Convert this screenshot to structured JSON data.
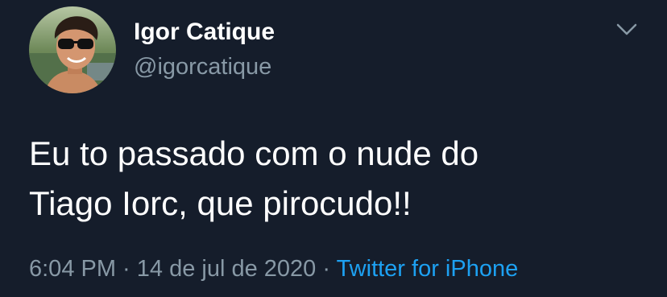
{
  "user": {
    "display_name": "Igor Catique",
    "handle": "@igorcatique",
    "avatar_icon": "profile-photo-avatar"
  },
  "tweet": {
    "text_line_1": "Eu to passado com o nude do",
    "text_line_2": "Tiago Iorc, que pirocudo!!",
    "time": "6:04 PM",
    "separator_1": " · ",
    "date": "14 de jul de 2020",
    "separator_2": " · ",
    "source": "Twitter for iPhone"
  },
  "menu": {
    "icon": "chevron-down-icon"
  },
  "colors": {
    "background": "#151d2b",
    "primary_text": "#ffffff",
    "secondary_text": "#8899a6",
    "link": "#1da1f2"
  }
}
